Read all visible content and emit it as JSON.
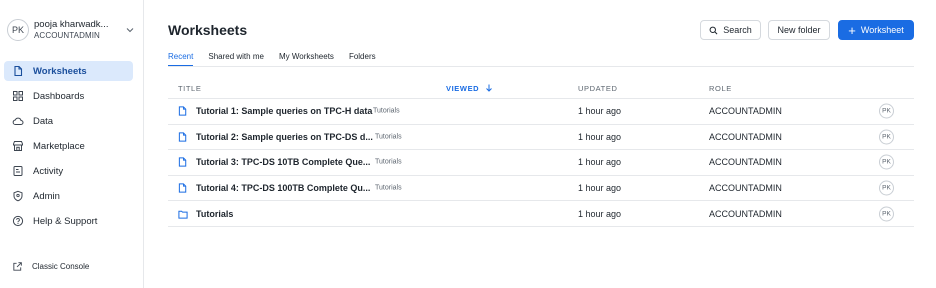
{
  "user": {
    "initials": "PK",
    "name": "pooja kharwadk...",
    "role": "ACCOUNTADMIN"
  },
  "sidebar": {
    "items": [
      {
        "label": "Worksheets",
        "icon": "file-icon",
        "active": true
      },
      {
        "label": "Dashboards",
        "icon": "grid-icon",
        "active": false
      },
      {
        "label": "Data",
        "icon": "cloud-icon",
        "active": false
      },
      {
        "label": "Marketplace",
        "icon": "store-icon",
        "active": false
      },
      {
        "label": "Activity",
        "icon": "activity-icon",
        "active": false
      },
      {
        "label": "Admin",
        "icon": "shield-icon",
        "active": false
      },
      {
        "label": "Help & Support",
        "icon": "help-icon",
        "active": false
      }
    ],
    "classic_console": "Classic Console"
  },
  "header": {
    "title": "Worksheets",
    "search_label": "Search",
    "new_folder_label": "New folder",
    "new_worksheet_label": "Worksheet"
  },
  "tabs": [
    "Recent",
    "Shared with me",
    "My Worksheets",
    "Folders"
  ],
  "table": {
    "columns": {
      "title": "TITLE",
      "viewed": "VIEWED",
      "updated": "UPDATED",
      "role": "ROLE"
    },
    "rows": [
      {
        "type": "worksheet",
        "name": "Tutorial 1: Sample queries on TPC-H data",
        "tag": "Tutorials",
        "updated": "1 hour ago",
        "role": "ACCOUNTADMIN",
        "owner": "PK"
      },
      {
        "type": "worksheet",
        "name": "Tutorial 2: Sample queries on TPC-DS d...",
        "tag": "Tutorials",
        "updated": "1 hour ago",
        "role": "ACCOUNTADMIN",
        "owner": "PK"
      },
      {
        "type": "worksheet",
        "name": "Tutorial 3: TPC-DS 10TB Complete Que...",
        "tag": "Tutorials",
        "updated": "1 hour ago",
        "role": "ACCOUNTADMIN",
        "owner": "PK"
      },
      {
        "type": "worksheet",
        "name": "Tutorial 4: TPC-DS 100TB Complete Qu...",
        "tag": "Tutorials",
        "updated": "1 hour ago",
        "role": "ACCOUNTADMIN",
        "owner": "PK"
      },
      {
        "type": "folder",
        "name": "Tutorials",
        "tag": "",
        "updated": "1 hour ago",
        "role": "ACCOUNTADMIN",
        "owner": "PK"
      }
    ]
  },
  "colors": {
    "accent": "#1a6ce3",
    "active_bg": "#dbe9fc"
  }
}
